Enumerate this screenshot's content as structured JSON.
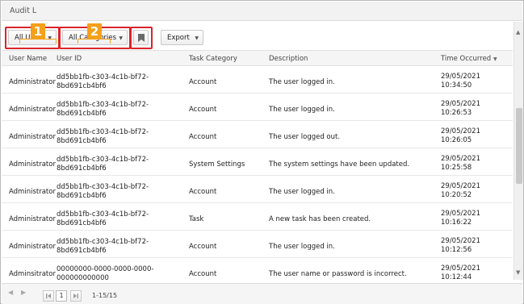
{
  "window": {
    "title": "Audit L"
  },
  "toolbar": {
    "users_dropdown": "All Users",
    "categories_dropdown": "All Categories",
    "export_label": "Export",
    "callouts": [
      "1",
      "2"
    ]
  },
  "table": {
    "columns": [
      "User Name",
      "User ID",
      "Task Category",
      "Description",
      "Time Occurred"
    ],
    "rows": [
      {
        "user": "Administrator",
        "id1": "dd5bb1fb-c303-4c1b-bf72-",
        "id2": "8bd691cb4bf6",
        "category": "Account",
        "description": "The user logged in.",
        "date": "29/05/2021",
        "time": "10:34:50"
      },
      {
        "user": "Administrator",
        "id1": "dd5bb1fb-c303-4c1b-bf72-",
        "id2": "8bd691cb4bf6",
        "category": "Account",
        "description": "The user logged in.",
        "date": "29/05/2021",
        "time": "10:26:53"
      },
      {
        "user": "Administrator",
        "id1": "dd5bb1fb-c303-4c1b-bf72-",
        "id2": "8bd691cb4bf6",
        "category": "Account",
        "description": "The user logged out.",
        "date": "29/05/2021",
        "time": "10:26:05"
      },
      {
        "user": "Administrator",
        "id1": "dd5bb1fb-c303-4c1b-bf72-",
        "id2": "8bd691cb4bf6",
        "category": "System Settings",
        "description": "The system settings have been updated.",
        "date": "29/05/2021",
        "time": "10:25:58"
      },
      {
        "user": "Administrator",
        "id1": "dd5bb1fb-c303-4c1b-bf72-",
        "id2": "8bd691cb4bf6",
        "category": "Account",
        "description": "The user logged in.",
        "date": "29/05/2021",
        "time": "10:20:52"
      },
      {
        "user": "Administrator",
        "id1": "dd5bb1fb-c303-4c1b-bf72-",
        "id2": "8bd691cb4bf6",
        "category": "Task",
        "description": "A new task has been created.",
        "date": "29/05/2021",
        "time": "10:16:22"
      },
      {
        "user": "Administrator",
        "id1": "dd5bb1fb-c303-4c1b-bf72-",
        "id2": "8bd691cb4bf6",
        "category": "Account",
        "description": "The user logged in.",
        "date": "29/05/2021",
        "time": "10:12:56"
      },
      {
        "user": "Adminsitrator",
        "id1": "00000000-0000-0000-0000-",
        "id2": "000000000000",
        "category": "Account",
        "description": "The user name or password is incorrect.",
        "date": "29/05/2021",
        "time": "10:12:44"
      }
    ]
  },
  "pager": {
    "current_page": "1",
    "range": "1-15/15"
  },
  "colors": {
    "callout": "#f5a019",
    "highlight": "#d9252b"
  }
}
